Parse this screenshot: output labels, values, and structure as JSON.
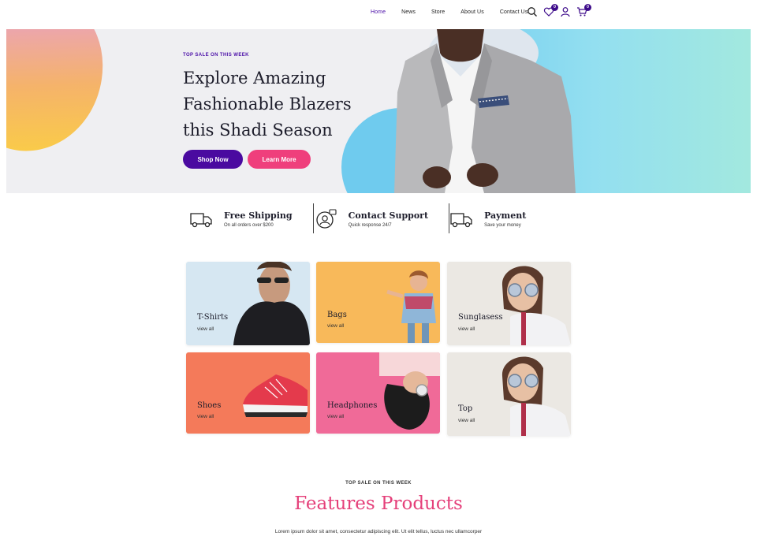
{
  "nav": {
    "links": [
      "Home",
      "News",
      "Store",
      "About Us",
      "Contact Us"
    ],
    "active": "Home",
    "icons": [
      "search-icon",
      "heart-icon",
      "user-icon",
      "cart-icon"
    ],
    "wishlist_count": "0",
    "cart_count": "0",
    "accent_color": "#4b0fa8"
  },
  "hero": {
    "eyebrow": "TOP SALE ON THIS WEEK",
    "title_line1": "Explore Amazing",
    "title_line2": "Fashionable Blazers",
    "title_line3": "this Shadi Season",
    "shop_label": "Shop Now",
    "learn_label": "Learn More",
    "shop_color": "#4a0aa0",
    "learn_color": "#ef3f7c"
  },
  "features": [
    {
      "icon": "truck-icon",
      "title": "Free Shipping",
      "sub": "On all orders over $200"
    },
    {
      "icon": "support-icon",
      "title": "Contact Support",
      "sub": "Quick response 24/7"
    },
    {
      "icon": "truck-icon",
      "title": "Payment",
      "sub": "Save your money"
    }
  ],
  "categories": [
    {
      "label": "T-Shirts",
      "link": "view all"
    },
    {
      "label": "Bags",
      "link": "view all"
    },
    {
      "label": "Sunglasess",
      "link": "view all"
    },
    {
      "label": "Shoes",
      "link": "view all"
    },
    {
      "label": "Headphones",
      "link": "view all"
    },
    {
      "label": "Top",
      "link": "view all"
    }
  ],
  "products": {
    "eyebrow": "TOP SALE ON THIS WEEK",
    "title": "Features Products",
    "desc": "Lorem ipsum dolor sit amet, consectetur adipiscing elit. Ut elit tellus, luctus nec ullamcorper",
    "title_color": "#e5407a"
  }
}
